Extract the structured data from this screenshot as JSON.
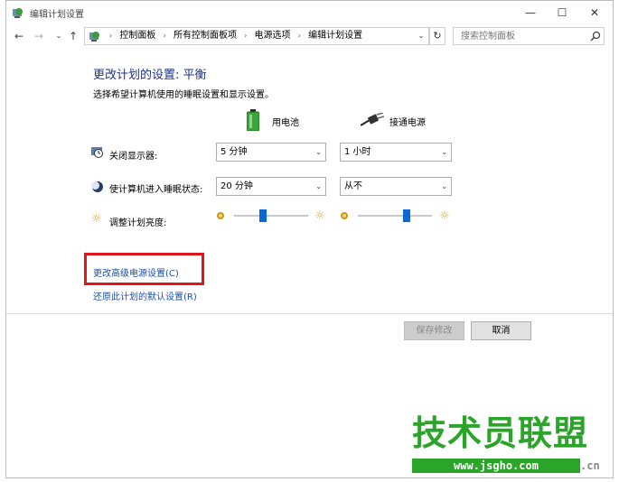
{
  "window": {
    "title": "编辑计划设置",
    "min_glyph": "—",
    "max_glyph": "☐",
    "close_glyph": "✕"
  },
  "nav": {
    "back_glyph": "←",
    "forward_glyph": "→",
    "recent_glyph": "⌄",
    "up_glyph": "↑",
    "breadcrumbs": [
      "控制面板",
      "所有控制面板项",
      "电源选项",
      "编辑计划设置"
    ],
    "sep_glyph": "›",
    "dropdown_glyph": "⌄",
    "refresh_glyph": "↻",
    "search_placeholder": "搜索控制面板"
  },
  "content": {
    "heading": "更改计划的设置: 平衡",
    "subheading": "选择希望计算机使用的睡眠设置和显示设置。",
    "col_battery": "用电池",
    "col_plugged": "接通电源",
    "rows": [
      {
        "label": "关闭显示器:",
        "battery": "5 分钟",
        "plugged": "1 小时",
        "icon": "monitor-clock-icon"
      },
      {
        "label": "使计算机进入睡眠状态:",
        "battery": "20 分钟",
        "plugged": "从不",
        "icon": "moon-icon"
      }
    ],
    "brightness": {
      "label": "调整计划亮度:",
      "battery_level": 0.38,
      "plugged_level": 0.68
    },
    "link_advanced": "更改高级电源设置(C)",
    "link_restore": "还原此计划的默认设置(R)",
    "btn_save": "保存修改",
    "btn_cancel": "取消",
    "caret_glyph": "⌄",
    "sun_glyph": "☼"
  },
  "colors": {
    "heading": "#1e3287",
    "link": "#1a4fb0",
    "highlight": "#e0161b",
    "slider": "#0a6ad4"
  },
  "watermark": {
    "text": "技术员联盟",
    "url": "www.jsgho.com",
    "suffix": ".cn"
  }
}
